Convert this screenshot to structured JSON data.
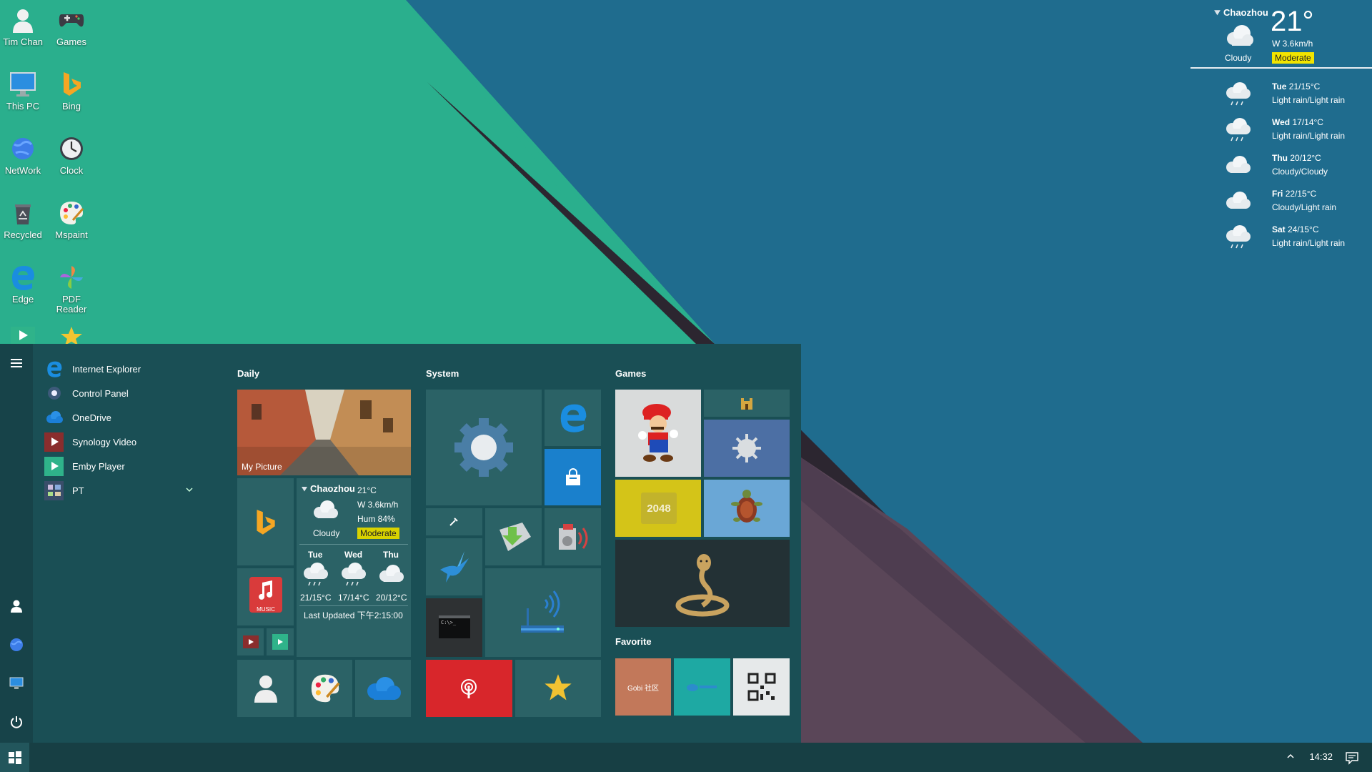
{
  "desktop": {
    "icons": [
      {
        "label": "Tim Chan",
        "icon": "user-icon"
      },
      {
        "label": "Games",
        "icon": "gamepad-icon"
      },
      {
        "label": "This PC",
        "icon": "monitor-icon"
      },
      {
        "label": "Bing",
        "icon": "bing-icon"
      },
      {
        "label": "NetWork",
        "icon": "globe-icon"
      },
      {
        "label": "Clock",
        "icon": "clock-icon"
      },
      {
        "label": "Recycled",
        "icon": "recycle-bin-icon"
      },
      {
        "label": "Mspaint",
        "icon": "palette-icon"
      },
      {
        "label": "Edge",
        "icon": "edge-icon"
      },
      {
        "label": "PDF\nReader",
        "icon": "pinwheel-icon"
      }
    ]
  },
  "weather_widget": {
    "city": "Chaozhou",
    "temperature": "21°",
    "wind": "W 3.6km/h",
    "condition": "Cloudy",
    "aqi": "Moderate",
    "forecast": [
      {
        "day": "Tue",
        "temps": "21/15°C",
        "desc": "Light rain/Light rain",
        "icon": "rain-cloud-icon"
      },
      {
        "day": "Wed",
        "temps": "17/14°C",
        "desc": "Light rain/Light rain",
        "icon": "rain-cloud-icon"
      },
      {
        "day": "Thu",
        "temps": "20/12°C",
        "desc": "Cloudy/Cloudy",
        "icon": "cloud-icon"
      },
      {
        "day": "Fri",
        "temps": "22/15°C",
        "desc": "Cloudy/Light rain",
        "icon": "cloud-icon"
      },
      {
        "day": "Sat",
        "temps": "24/15°C",
        "desc": "Light rain/Light rain",
        "icon": "rain-cloud-icon"
      }
    ]
  },
  "start_menu": {
    "apps": [
      {
        "label": "Internet Explorer",
        "icon": "edge-icon"
      },
      {
        "label": "Control Panel",
        "icon": "settings-icon"
      },
      {
        "label": "OneDrive",
        "icon": "onedrive-icon"
      },
      {
        "label": "Synology Video",
        "icon": "video-icon"
      },
      {
        "label": "Emby Player",
        "icon": "play-icon"
      },
      {
        "label": "PT",
        "icon": "pt-icon"
      }
    ],
    "groups": {
      "daily": "Daily",
      "system": "System",
      "games": "Games",
      "favorite": "Favorite"
    },
    "my_picture": "My Picture",
    "weather_tile": {
      "city": "Chaozhou",
      "temp": "21°C",
      "wind": "W 3.6km/h",
      "humidity": "Hum 84%",
      "condition": "Cloudy",
      "aqi": "Moderate",
      "days": [
        {
          "day": "Tue",
          "temps": "21/15°C"
        },
        {
          "day": "Wed",
          "temps": "17/14°C"
        },
        {
          "day": "Thu",
          "temps": "20/12°C"
        }
      ],
      "updated": "Last Updated 下午2:15:00"
    },
    "music_label": "MUSIC",
    "game_2048": "2048",
    "favorite_tiles": [
      "Gobi 社区",
      "",
      ""
    ]
  },
  "taskbar": {
    "time": "14:32"
  },
  "colors": {
    "wallpaper_green": "#2aaf8d",
    "wallpaper_blue": "#1f6c8e",
    "wallpaper_dark": "#2f2630",
    "wallpaper_mauve": "#5a4658",
    "start_bg": "#1a4f55",
    "aqi_yellow": "#f2e400",
    "tile_red": "#d8262b",
    "tile_blue": "#1a80cc",
    "tile_yellow": "#d4c418",
    "tile_orange": "#c2785a",
    "tile_teal": "#1ea9a3"
  }
}
